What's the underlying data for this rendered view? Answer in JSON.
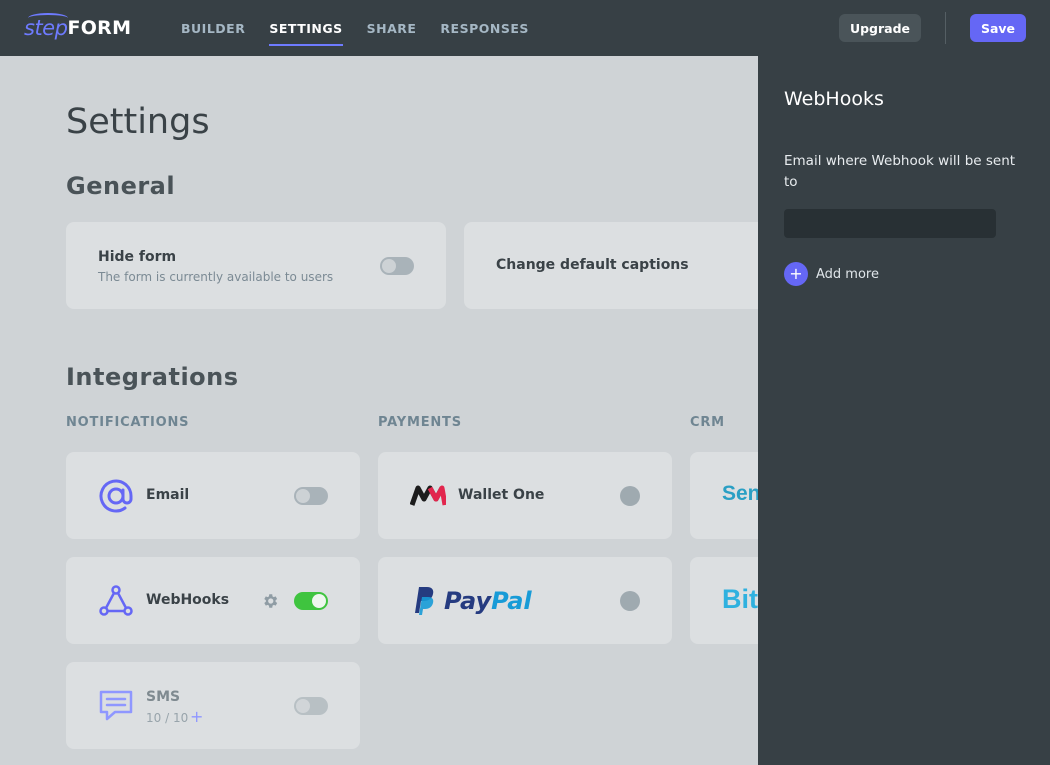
{
  "brand": {
    "logo_step": "step",
    "logo_form": "FORM"
  },
  "nav": {
    "items": [
      {
        "label": "BUILDER",
        "active": false
      },
      {
        "label": "SETTINGS",
        "active": true
      },
      {
        "label": "SHARE",
        "active": false
      },
      {
        "label": "RESPONSES",
        "active": false
      }
    ]
  },
  "toolbar": {
    "upgrade_label": "Upgrade",
    "save_label": "Save"
  },
  "page": {
    "title": "Settings"
  },
  "general": {
    "title": "General",
    "hide_form": {
      "title": "Hide form",
      "subtitle": "The form is currently available to users",
      "enabled": false
    },
    "change_captions": {
      "title": "Change default captions"
    }
  },
  "integrations": {
    "title": "Integrations",
    "notifications": {
      "label": "NOTIFICATIONS",
      "email": {
        "name": "Email",
        "icon": "at-icon",
        "enabled": false
      },
      "webhooks": {
        "name": "WebHooks",
        "icon": "webhook-icon",
        "enabled": true
      },
      "sms": {
        "name": "SMS",
        "icon": "chat-icon",
        "count": "10 / 10",
        "add": "+",
        "enabled": false
      }
    },
    "payments": {
      "label": "PAYMENTS",
      "wallet_one": {
        "name": "Wallet One",
        "logo_icon": "wallet-one-logo-icon"
      },
      "paypal": {
        "name_a": "Pay",
        "name_b": "Pal",
        "logo_icon": "paypal-logo-icon"
      }
    },
    "crm": {
      "label": "CRM",
      "item1": {
        "name": "Sen"
      },
      "item2": {
        "name": "Bit"
      }
    }
  },
  "panel": {
    "title": "WebHooks",
    "email_label": "Email where Webhook will be sent to",
    "email_value": "",
    "email_placeholder": "",
    "add_more_label": "Add more",
    "add_more_icon": "+"
  },
  "colors": {
    "accent": "#6567f5",
    "topbar": "#374045",
    "toggle_on": "#3fc43f",
    "crm_teal": "#2a9fc4",
    "paypal_dark": "#253b80",
    "paypal_light": "#179bd7"
  }
}
